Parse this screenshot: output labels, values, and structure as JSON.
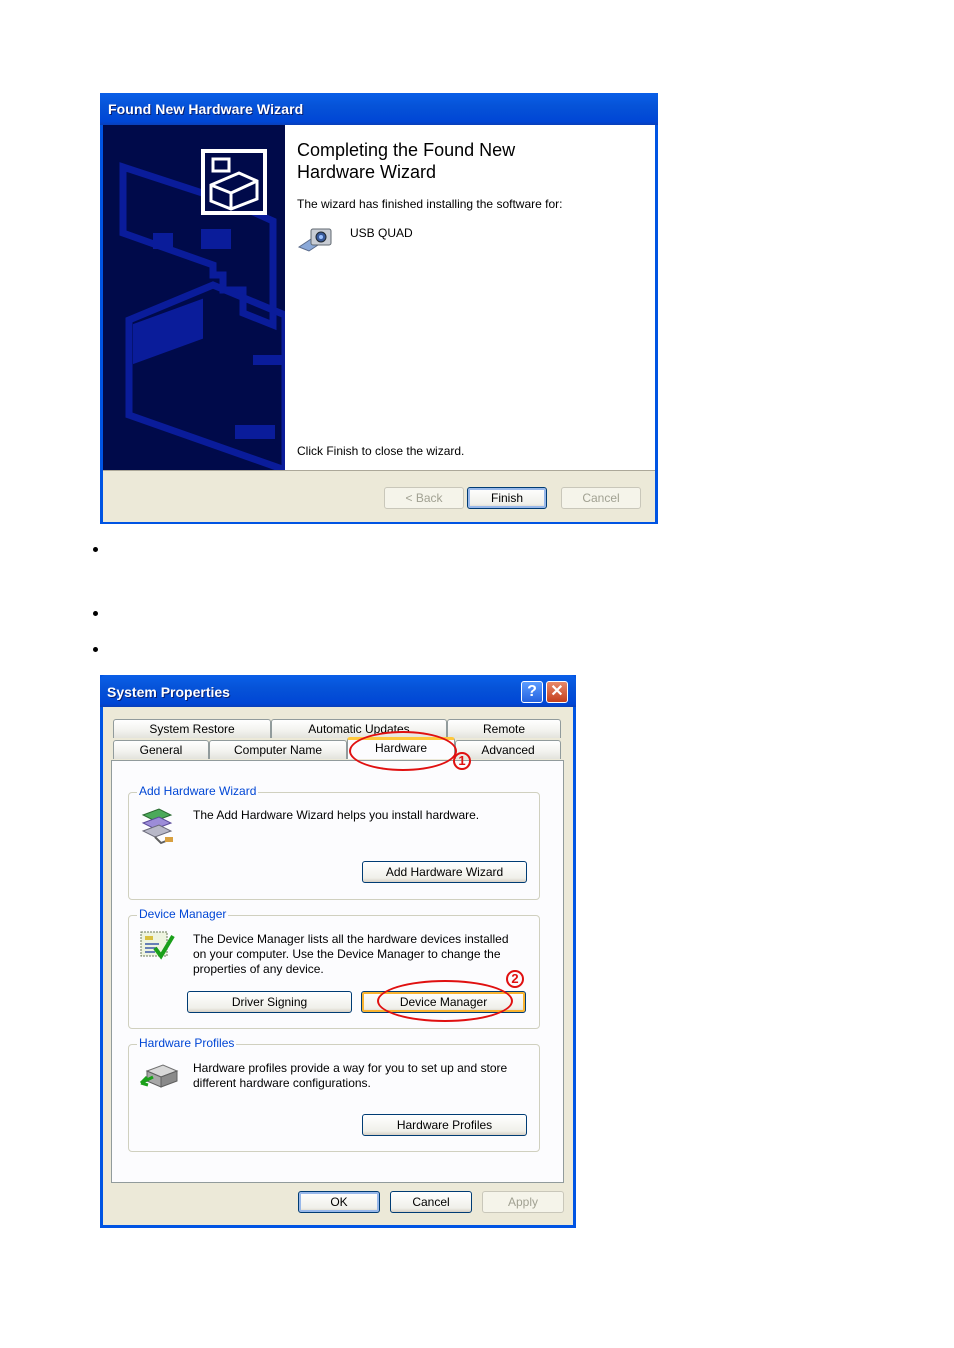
{
  "wizard": {
    "title": "Found New Hardware Wizard",
    "heading_line1": "Completing the Found New",
    "heading_line2": "Hardware Wizard",
    "finished_text": "The wizard has finished installing the software for:",
    "device_name": "USB QUAD",
    "device_icon": "camera-device-icon",
    "close_hint": "Click Finish to close the wizard.",
    "buttons": {
      "back": "< Back",
      "finish": "Finish",
      "cancel": "Cancel"
    },
    "colors": {
      "title_bar": "#0054e3",
      "left_pane": "#000a4a",
      "footer": "#ece9d8"
    }
  },
  "bullets": [
    "",
    "",
    ""
  ],
  "system_properties": {
    "title": "System Properties",
    "title_buttons": {
      "help": "?",
      "close": "✕"
    },
    "tabs_row1": [
      "System Restore",
      "Automatic Updates",
      "Remote"
    ],
    "tabs_row2": [
      "General",
      "Computer Name",
      "Hardware",
      "Advanced"
    ],
    "active_tab": "Hardware",
    "groups": {
      "add_hardware": {
        "label": "Add Hardware Wizard",
        "text": "The Add Hardware Wizard helps you install hardware.",
        "button": "Add Hardware Wizard"
      },
      "device_manager": {
        "label": "Device Manager",
        "text_line1": "The Device Manager lists all the hardware devices installed",
        "text_line2": "on your computer. Use the Device Manager to change the",
        "text_line3": "properties of any device.",
        "button_driver_signing": "Driver Signing",
        "button_device_manager": "Device Manager"
      },
      "hardware_profiles": {
        "label": "Hardware Profiles",
        "text_line1": "Hardware profiles provide a way for you to set up and store",
        "text_line2": "different hardware configurations.",
        "button": "Hardware Profiles"
      }
    },
    "buttons": {
      "ok": "OK",
      "cancel": "Cancel",
      "apply": "Apply"
    },
    "annotations": {
      "step1": "1",
      "step2": "2",
      "color": "#e01010"
    }
  }
}
